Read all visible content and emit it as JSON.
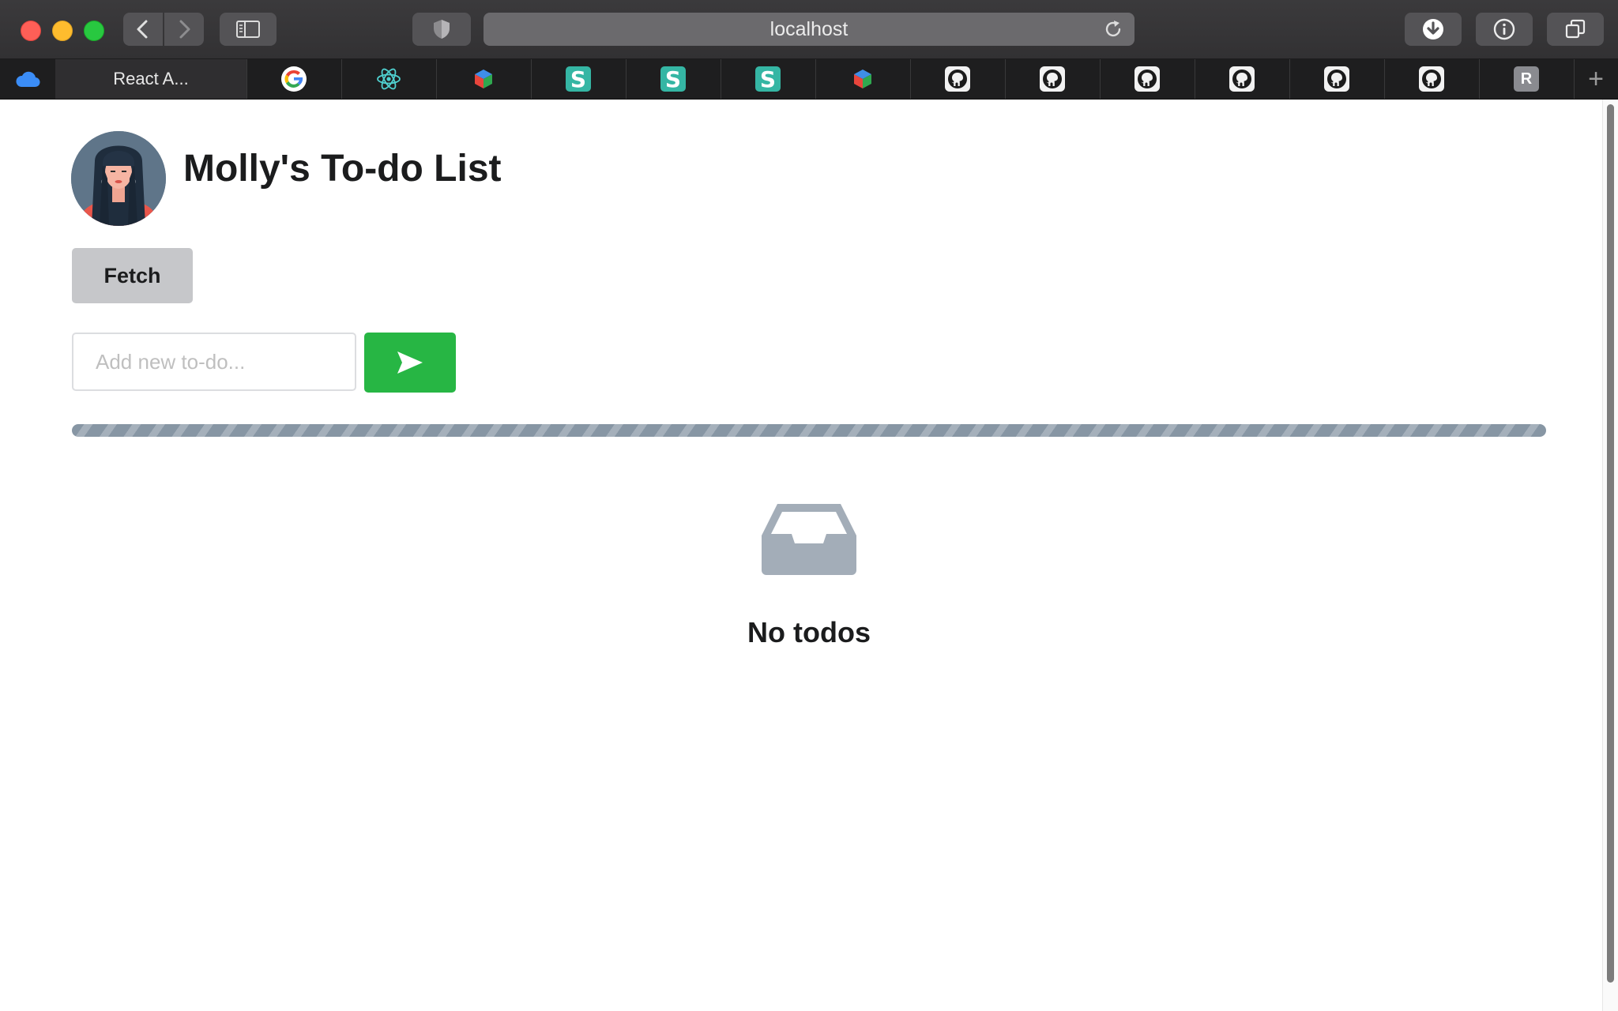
{
  "browser": {
    "url": "localhost",
    "active_tab_label": "React A...",
    "tabs": [
      {
        "icon": "google-icon"
      },
      {
        "icon": "react-icon"
      },
      {
        "icon": "cube-icon"
      },
      {
        "icon": "s-icon",
        "letter": "S"
      },
      {
        "icon": "s-icon",
        "letter": "S"
      },
      {
        "icon": "s-icon",
        "letter": "S"
      },
      {
        "icon": "cube-icon"
      },
      {
        "icon": "github-icon"
      },
      {
        "icon": "github-icon"
      },
      {
        "icon": "github-icon"
      },
      {
        "icon": "github-icon"
      },
      {
        "icon": "github-icon"
      },
      {
        "icon": "github-icon"
      },
      {
        "icon": "r-icon",
        "letter": "R"
      }
    ],
    "new_tab_label": "+"
  },
  "app": {
    "title": "Molly's To-do List",
    "fetch_label": "Fetch",
    "input_placeholder": "Add new to-do...",
    "input_value": "",
    "empty_message": "No todos"
  },
  "colors": {
    "accent_green": "#27b644",
    "progress": "#8796a4",
    "empty_icon": "#a3adb8"
  }
}
